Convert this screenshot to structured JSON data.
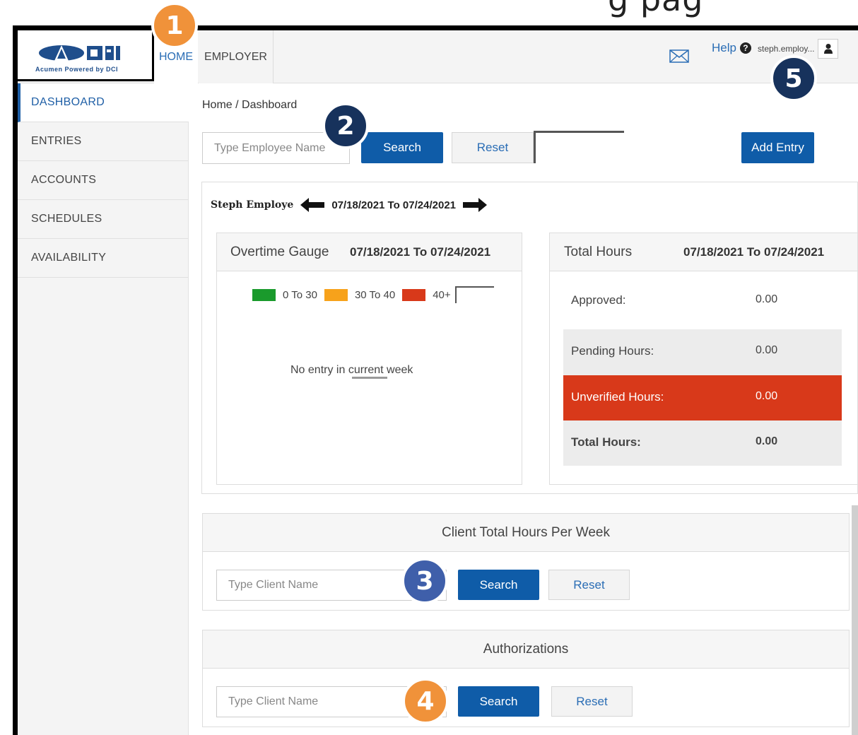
{
  "top_caption": "g pag",
  "logo": {
    "text": "Acumen Powered by DCI"
  },
  "nav": {
    "home": "HOME",
    "employer": "EMPLOYER"
  },
  "header": {
    "help": "Help",
    "help_icon": "?",
    "user": "steph.employ..."
  },
  "sidebar": {
    "items": [
      {
        "label": "DASHBOARD"
      },
      {
        "label": "ENTRIES"
      },
      {
        "label": "ACCOUNTS"
      },
      {
        "label": "SCHEDULES"
      },
      {
        "label": "AVAILABILITY"
      }
    ]
  },
  "breadcrumb": "Home / Dashboard",
  "employee_search": {
    "placeholder": "Type Employee Name",
    "search_label": "Search",
    "reset_label": "Reset",
    "add_entry_label": "Add Entry"
  },
  "week": {
    "employee": "Steph Employe",
    "range": "07/18/2021 To 07/24/2021"
  },
  "overtime": {
    "title": "Overtime Gauge",
    "dates": "07/18/2021 To 07/24/2021",
    "legend": [
      {
        "label": "0 To 30",
        "color": "#1a9a2c"
      },
      {
        "label": "30 To 40",
        "color": "#f7a21b"
      },
      {
        "label": "40+",
        "color": "#d8391a"
      }
    ],
    "empty_message": "No entry in current week"
  },
  "total_hours": {
    "title": "Total Hours",
    "dates": "07/18/2021 To 07/24/2021",
    "rows": [
      {
        "label": "Approved:",
        "value": "0.00"
      },
      {
        "label": "Pending Hours:",
        "value": "0.00"
      },
      {
        "label": "Unverified Hours:",
        "value": "0.00"
      },
      {
        "label": "Total Hours:",
        "value": "0.00"
      }
    ],
    "highlight_color": "#d8391a"
  },
  "client_hours": {
    "title": "Client Total Hours Per Week",
    "placeholder": "Type Client Name",
    "search_label": "Search",
    "reset_label": "Reset"
  },
  "authorizations": {
    "title": "Authorizations",
    "placeholder": "Type Client Name",
    "search_label": "Search",
    "reset_label": "Reset"
  },
  "badges": [
    "1",
    "2",
    "3",
    "4",
    "5"
  ]
}
